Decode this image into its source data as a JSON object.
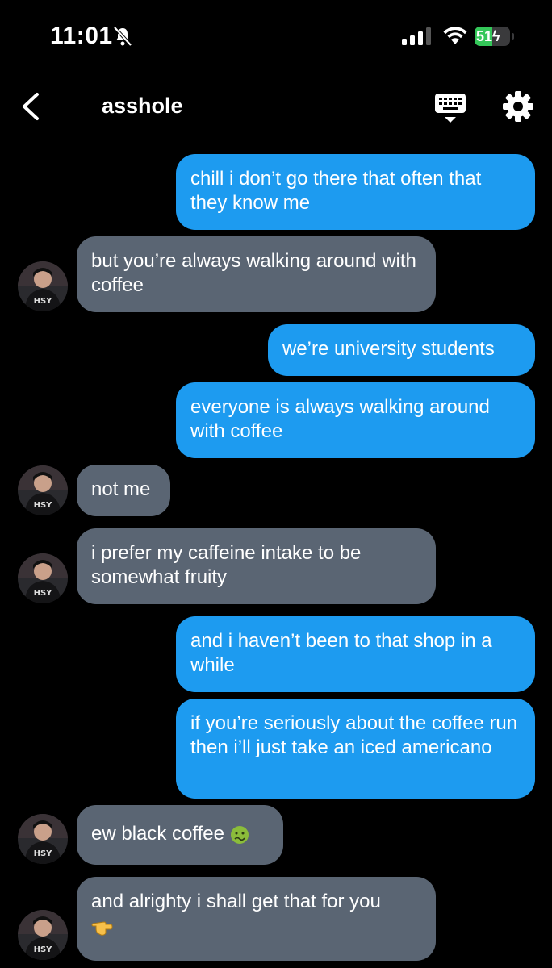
{
  "status": {
    "time": "11:01",
    "battery": "51",
    "battery_level": 0.51
  },
  "header": {
    "title": "asshole"
  },
  "messages": [
    {
      "dir": "out",
      "text": "chill i don’t go there that often that they know me"
    },
    {
      "dir": "in",
      "text": "but you’re always walking around with coffee"
    },
    {
      "dir": "out",
      "text": "we’re university students"
    },
    {
      "dir": "out",
      "text": "everyone is always walking around with coffee"
    },
    {
      "dir": "in",
      "text": "not me"
    },
    {
      "dir": "in",
      "text": "i prefer my caffeine intake to be somewhat fruity"
    },
    {
      "dir": "out",
      "text": "and i haven’t been to that shop in a while"
    },
    {
      "dir": "out",
      "text": "if you’re seriously about the coffee run then i’ll just take an iced americano"
    },
    {
      "dir": "in",
      "text": "ew black coffee",
      "emoji": "nauseated-face"
    },
    {
      "dir": "in",
      "text": "and alrighty i shall get that for you",
      "emoji": "pointing-hand"
    }
  ],
  "avatar": {
    "shirt_text": "HSY"
  },
  "colors": {
    "outgoing": "#1d9bf0",
    "incoming": "#5a6573",
    "background": "#000000"
  }
}
